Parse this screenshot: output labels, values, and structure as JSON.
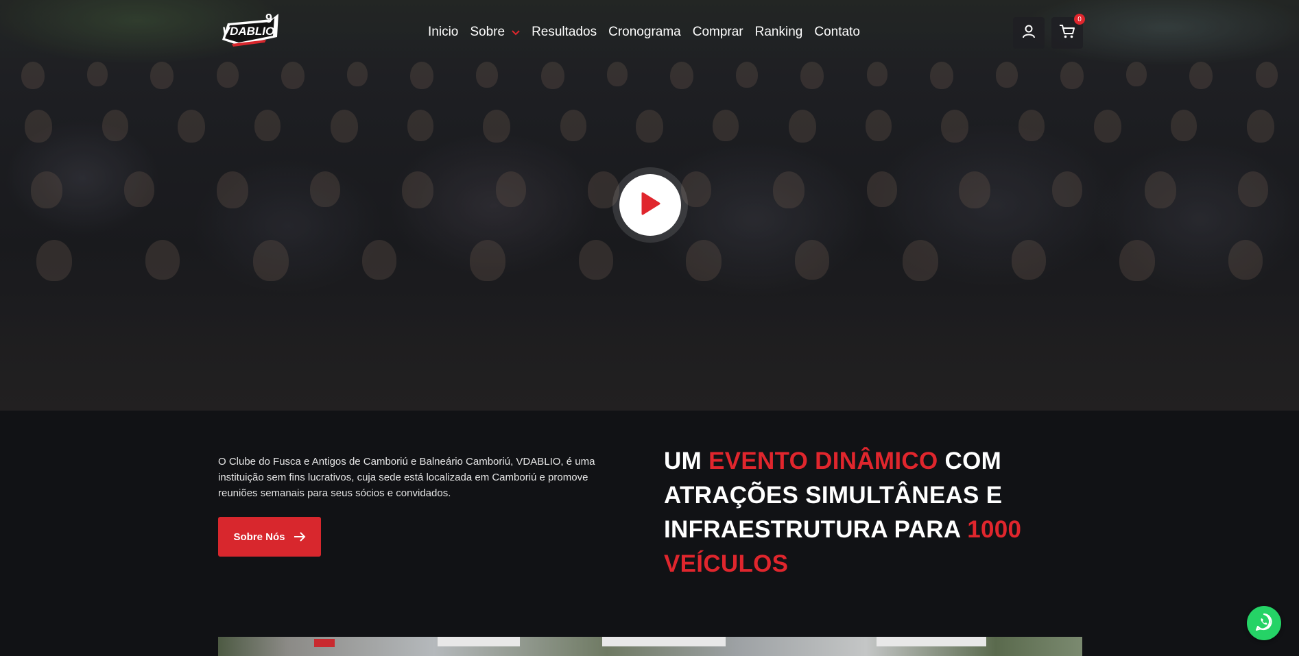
{
  "brand": {
    "logo_text": "VDABLIO",
    "logo_number": "9"
  },
  "nav": {
    "items": [
      {
        "label": "Inicio"
      },
      {
        "label": "Sobre",
        "has_dropdown": true
      },
      {
        "label": "Resultados"
      },
      {
        "label": "Cronograma"
      },
      {
        "label": "Comprar"
      },
      {
        "label": "Ranking"
      },
      {
        "label": "Contato"
      }
    ]
  },
  "header": {
    "cart_count": "0",
    "user_icon": "user-icon",
    "cart_icon": "cart-icon"
  },
  "hero": {
    "play_icon": "play-icon"
  },
  "about": {
    "description": "O Clube do Fusca e Antigos de Camboriú e Balneário Camboriú, VDABLIO, é uma instituição sem fins lucrativos, cuja sede está localizada em Camboriú e promove reuniões semanais para seus sócios e convidados.",
    "button_label": "Sobre Nós"
  },
  "headline": {
    "part1": "UM ",
    "part2": "EVENTO DINÂMICO",
    "part3": " COM ATRAÇÕES SIMULTÂNEAS E INFRAESTRUTURA PARA ",
    "part4": "1000 VEÍCULOS"
  },
  "colors": {
    "accent": "#e0262d",
    "background": "#111215",
    "whatsapp": "#25d366"
  }
}
